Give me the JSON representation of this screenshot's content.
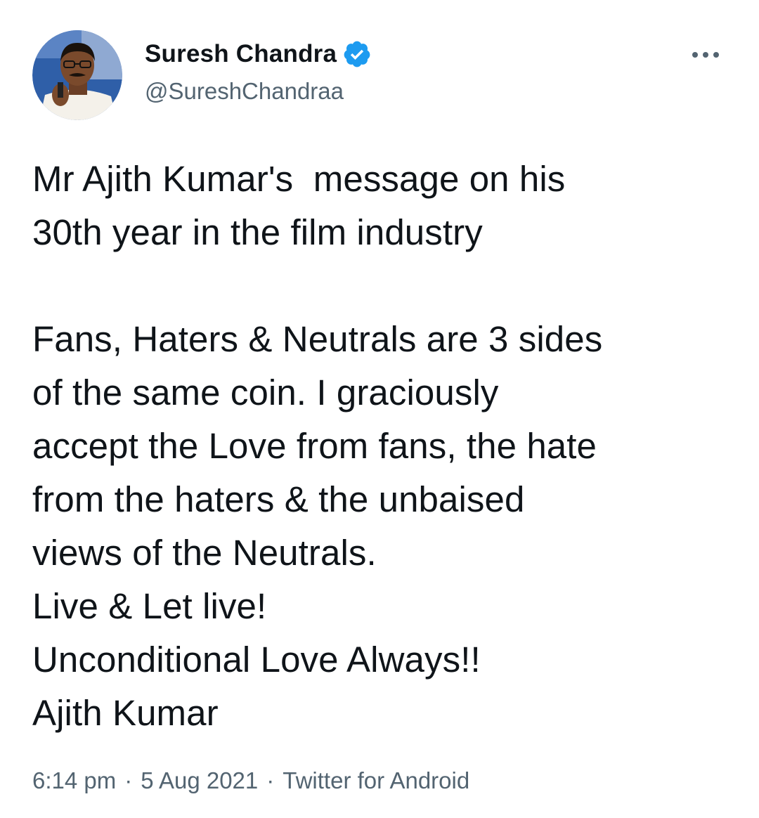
{
  "author": {
    "display_name": "Suresh Chandra",
    "handle": "@SureshChandraa",
    "verified": true
  },
  "icons": {
    "verified": "verified-badge-icon",
    "more": "more-options-icon"
  },
  "colors": {
    "verified_blue": "#1d9bf0",
    "text_primary": "#0f1419",
    "text_secondary": "#536471"
  },
  "tweet": {
    "text": "Mr Ajith Kumar's  message on his\n30th year in the film industry\n\nFans, Haters & Neutrals are 3 sides\nof the same coin. I graciously\naccept the Love from fans, the hate\nfrom the haters & the unbaised\nviews of the Neutrals.\nLive & Let live!\nUnconditional Love Always!!\nAjith Kumar"
  },
  "meta": {
    "time": "6:14 pm",
    "separator": "·",
    "date": "5 Aug 2021",
    "source": "Twitter for Android"
  }
}
